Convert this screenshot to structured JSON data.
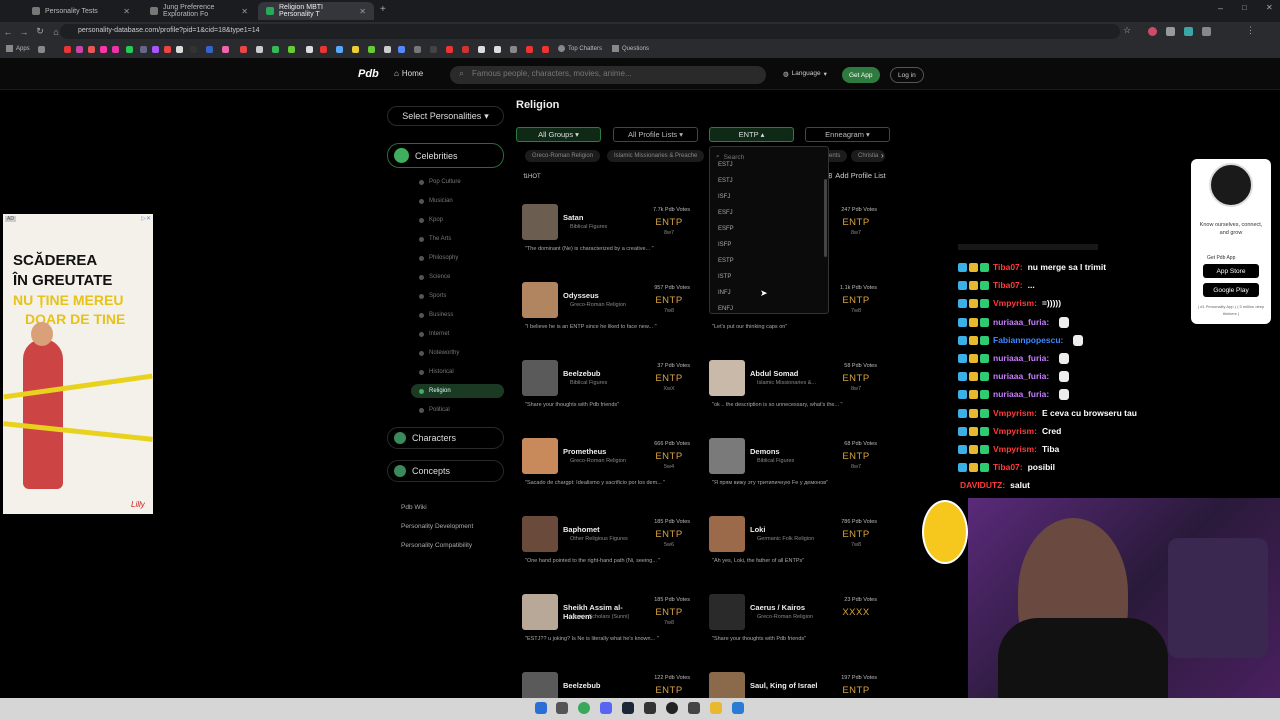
{
  "browser": {
    "tabs": [
      {
        "label": "Personality Tests",
        "active": false
      },
      {
        "label": "Jung Preference Exploration Fo",
        "active": false
      },
      {
        "label": "Religion MBTI Personality T",
        "active": true
      }
    ],
    "url": "personality-database.com/profile?pid=1&cid=18&type1=14",
    "bookmarks": {
      "apps": "Apps",
      "top_chatters": "Top Chatters",
      "questions": "Questions"
    }
  },
  "topnav": {
    "logo": "Pdb",
    "home": "Home",
    "search_placeholder": "Famous people, characters, movies, anime...",
    "language": "Language",
    "get_app": "Get App",
    "login": "Log in"
  },
  "sidebar": {
    "select_personalities": "Select Personalities",
    "celebrities": "Celebrities",
    "items": [
      "Pop Culture",
      "Musician",
      "Kpop",
      "The Arts",
      "Philosophy",
      "Science",
      "Sports",
      "Business",
      "Internet",
      "Noteworthy",
      "Historical",
      "Religion",
      "Political"
    ],
    "active_item": "Religion",
    "characters": "Characters",
    "concepts": "Concepts",
    "links": [
      "Pdb Wiki",
      "Personality Development",
      "Personality Compatibility"
    ]
  },
  "main": {
    "title": "Religion",
    "filters": {
      "groups": "All Groups",
      "lists": "All Profile Lists",
      "type": "ENTP",
      "enneagram": "Enneagram"
    },
    "pills": [
      "Greco-Roman Religion",
      "Islamic Missionaries & Preache",
      "ents",
      "Christia"
    ],
    "hot": "HOT",
    "add_profile_list": "Add Profile List",
    "dropdown": {
      "search_placeholder": "Search",
      "options": [
        "ESTJ",
        "ESTJ",
        "ISFJ",
        "ESFJ",
        "ESFP",
        "ISFP",
        "ESTP",
        "ISTP",
        "INFJ",
        "ENFJ"
      ]
    },
    "cards": [
      {
        "name": "Satan",
        "category": "Biblical Figures",
        "votes": "7.7k Pdb Votes",
        "type": "ENTP",
        "sub": "8w7",
        "quote": "\"The dominant (Ne) is characterized by a creative... \"",
        "color": "#6b5d4f"
      },
      {
        "name": "",
        "category": "",
        "votes": "247 Pdb Votes",
        "type": "ENTP",
        "sub": "8w7",
        "quote": "the VILLAINS?...\"",
        "color": "#000000"
      },
      {
        "name": "Odysseus",
        "category": "Greco-Roman Religion",
        "votes": "957 Pdb Votes",
        "type": "ENTP",
        "sub": "7w8",
        "quote": "\"I believe he is an ENTP since he liked to face new... \"",
        "color": "#b0855f"
      },
      {
        "name": "",
        "category": "",
        "votes": "1.1k Pdb Votes",
        "type": "ENTP",
        "sub": "7w8",
        "quote": "\"Let's put our thinking caps on\"",
        "color": "#000000"
      },
      {
        "name": "Beelzebub",
        "category": "Biblical Figures",
        "votes": "37 Pdb Votes",
        "type": "ENTP",
        "sub": "XwX",
        "quote": "\"Share your thoughts with Pdb friends\"",
        "color": "#5a5a5a"
      },
      {
        "name": "Abdul Somad",
        "category": "Islamic Missionaries &...",
        "votes": "58 Pdb Votes",
        "type": "ENTP",
        "sub": "8w7",
        "quote": "\"ok .. the description is so unnecessary, what's the... \"",
        "color": "#c9b9a8"
      },
      {
        "name": "Prometheus",
        "category": "Greco-Roman Religion",
        "votes": "666 Pdb Votes",
        "type": "ENTP",
        "sub": "5w4",
        "quote": "\"Sacado de chargpt: Idealismo y sacrificio por los dem... \"",
        "color": "#c88a5a"
      },
      {
        "name": "Demons",
        "category": "Biblical Figures",
        "votes": "68 Pdb Votes",
        "type": "ENTP",
        "sub": "8w7",
        "quote": "\"Я прям вижу эту тритипичную Fe у демонов\"",
        "color": "#7a7a7a"
      },
      {
        "name": "Baphomet",
        "category": "Other Religious Figures",
        "votes": "185 Pdb Votes",
        "type": "ENTP",
        "sub": "5w6",
        "quote": "\"One hand pointed to the right-hand path (Ni, seeing... \"",
        "color": "#6a4a3a"
      },
      {
        "name": "Loki",
        "category": "Germanic Folk Religion",
        "votes": "786 Pdb Votes",
        "type": "ENTP",
        "sub": "7w8",
        "quote": "\"Ah yes, Loki, the father of all ENTPs\"",
        "color": "#9a6a4a"
      },
      {
        "name": "Sheikh Assim al-Hakeem",
        "category": "Islamic Scholars (Sunni)",
        "votes": "185 Pdb Votes",
        "type": "ENTP",
        "sub": "7w8",
        "quote": "\"ESTJ?? u joking? Is Ne is literally what he's known... \"",
        "color": "#b8a898"
      },
      {
        "name": "Caerus / Kairos",
        "category": "Greco-Roman Religion",
        "votes": "23 Pdb Votes",
        "type": "XXXX",
        "sub": "",
        "quote": "\"Share your thoughts with Pdb friends\"",
        "color": "#2a2a2a"
      },
      {
        "name": "Beelzebub",
        "category": "",
        "votes": "122 Pdb Votes",
        "type": "ENTP",
        "sub": "",
        "quote": "",
        "color": "#5a5a5a"
      },
      {
        "name": "Saul, King of Israel",
        "category": "",
        "votes": "197 Pdb Votes",
        "type": "ENTP",
        "sub": "",
        "quote": "",
        "color": "#8a6a4a"
      }
    ]
  },
  "ad": {
    "badge": "AD",
    "line1": "SCĂDEREA",
    "line2": "ÎN GREUTATE",
    "line3": "NU ȚINE MEREU",
    "line4": "DOAR DE TINE",
    "brand": "Lilly"
  },
  "app_widget": {
    "text": "Know ourselves, connect, and grow",
    "get_app": "Get Pdb App",
    "app_store": "App Store",
    "google_play": "Google Play",
    "footnote": "( #1 Personality App ) ( 5 million deep thinkers )"
  },
  "chat": [
    {
      "user": "Tiba07:",
      "msg": "nu merge sa l trimit",
      "color": "#ff3b3b"
    },
    {
      "user": "Tiba07:",
      "msg": "...",
      "color": "#ff3b3b"
    },
    {
      "user": "Vmpyrism:",
      "msg": "=)))))",
      "color": "#ff3b3b"
    },
    {
      "user": "nuriaaa_furia:",
      "msg": "",
      "color": "#c77dff"
    },
    {
      "user": "Fabiannpopescu:",
      "msg": "",
      "color": "#3b8bff"
    },
    {
      "user": "nuriaaa_furia:",
      "msg": "",
      "color": "#c77dff"
    },
    {
      "user": "nuriaaa_furia:",
      "msg": "",
      "color": "#c77dff"
    },
    {
      "user": "nuriaaa_furia:",
      "msg": "",
      "color": "#c77dff"
    },
    {
      "user": "Vmpyrism:",
      "msg": "E ceva cu browseru tau",
      "color": "#ff3b3b"
    },
    {
      "user": "Vmpyrism:",
      "msg": "Cred",
      "color": "#ff3b3b"
    },
    {
      "user": "Vmpyrism:",
      "msg": "Tiba",
      "color": "#ff3b3b"
    },
    {
      "user": "Tiba07:",
      "msg": "posibil",
      "color": "#ff3b3b"
    },
    {
      "user": "DAVIDUTZ:",
      "msg": "salut",
      "color": "#ff3b3b"
    }
  ]
}
